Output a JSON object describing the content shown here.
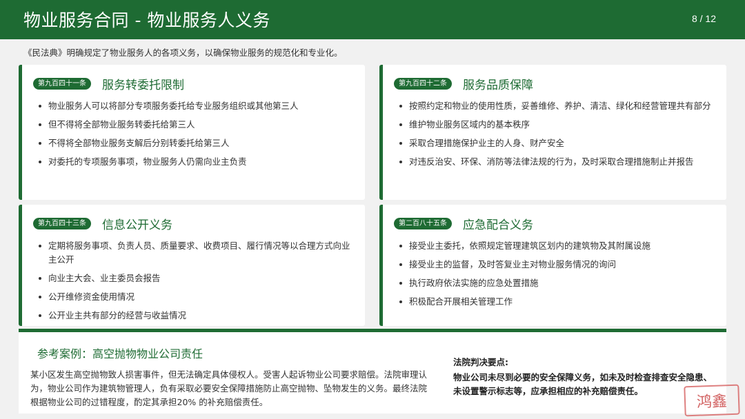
{
  "header": {
    "title": "物业服务合同 -  物业服务人义务",
    "page_number": "8 / 12"
  },
  "intro": "《民法典》明确规定了物业服务人的各项义务，以确保物业服务的规范化和专业化。",
  "cards": [
    {
      "badge": "第九百四十一条",
      "title": "服务转委托限制",
      "items": [
        "物业服务人可以将部分专项服务委托给专业服务组织或其他第三人",
        "但不得将全部物业服务转委托给第三人",
        "不得将全部物业服务支解后分别转委托给第三人",
        "对委托的专项服务事项，物业服务人仍需向业主负责"
      ]
    },
    {
      "badge": "第九百四十二条",
      "title": "服务品质保障",
      "items": [
        "按照约定和物业的使用性质，妥善维修、养护、清洁、绿化和经营管理共有部分",
        "维护物业服务区域内的基本秩序",
        "采取合理措施保护业主的人身、财产安全",
        "对违反治安、环保、消防等法律法规的行为，及时采取合理措施制止并报告"
      ]
    },
    {
      "badge": "第九百四十三条",
      "title": "信息公开义务",
      "items": [
        "定期将服务事项、负责人员、质量要求、收费项目、履行情况等以合理方式向业主公开",
        "向业主大会、业主委员会报告",
        "公开维修资金使用情况",
        "公开业主共有部分的经营与收益情况"
      ]
    },
    {
      "badge": "第二百八十五条",
      "title": "应急配合义务",
      "items": [
        "接受业主委托，依照规定管理建筑区划内的建筑物及其附属设施",
        "接受业主的监督，及时答复业主对物业服务情况的询问",
        "执行政府依法实施的应急处置措施",
        "积极配合开展相关管理工作"
      ]
    }
  ],
  "case": {
    "title": "参考案例：高空抛物物业公司责任",
    "body": "某小区发生高空抛物致人损害事件，但无法确定具体侵权人。受害人起诉物业公司要求赔偿。法院审理认为，物业公司作为建筑物管理人，负有采取必要安全保障措施防止高空抛物、坠物发生的义务。最终法院根据物业公司的过错程度，酌定其承担20% 的补充赔偿责任。",
    "ruling_title": "法院判决要点:",
    "ruling_body": "物业公司未尽到必要的安全保障义务，如未及时检查排查安全隐患、未设置警示标志等，应承担相应的补充赔偿责任。"
  },
  "stamp": "鸿鑫"
}
